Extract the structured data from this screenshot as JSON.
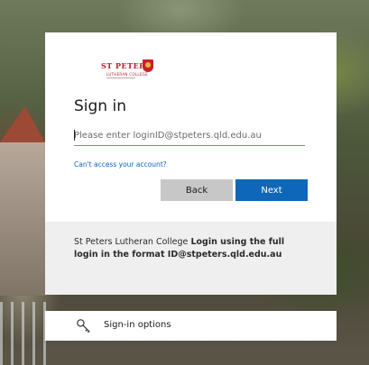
{
  "logo": {
    "name": "ST PETERS",
    "subtitle": "LUTHERAN COLLEGE"
  },
  "signin": {
    "title": "Sign in",
    "input_placeholder": "Please enter loginID@stpeters.qld.edu.au",
    "input_value": "",
    "cant_access_link": "Can't access your account?",
    "back_label": "Back",
    "next_label": "Next",
    "accent_color": "#0e67b8"
  },
  "info": {
    "prefix": "St Peters Lutheran College ",
    "bold": "Login using the full login in the format ID@stpeters.qld.edu.au"
  },
  "options": {
    "label": "Sign-in options",
    "icon": "key-icon"
  }
}
